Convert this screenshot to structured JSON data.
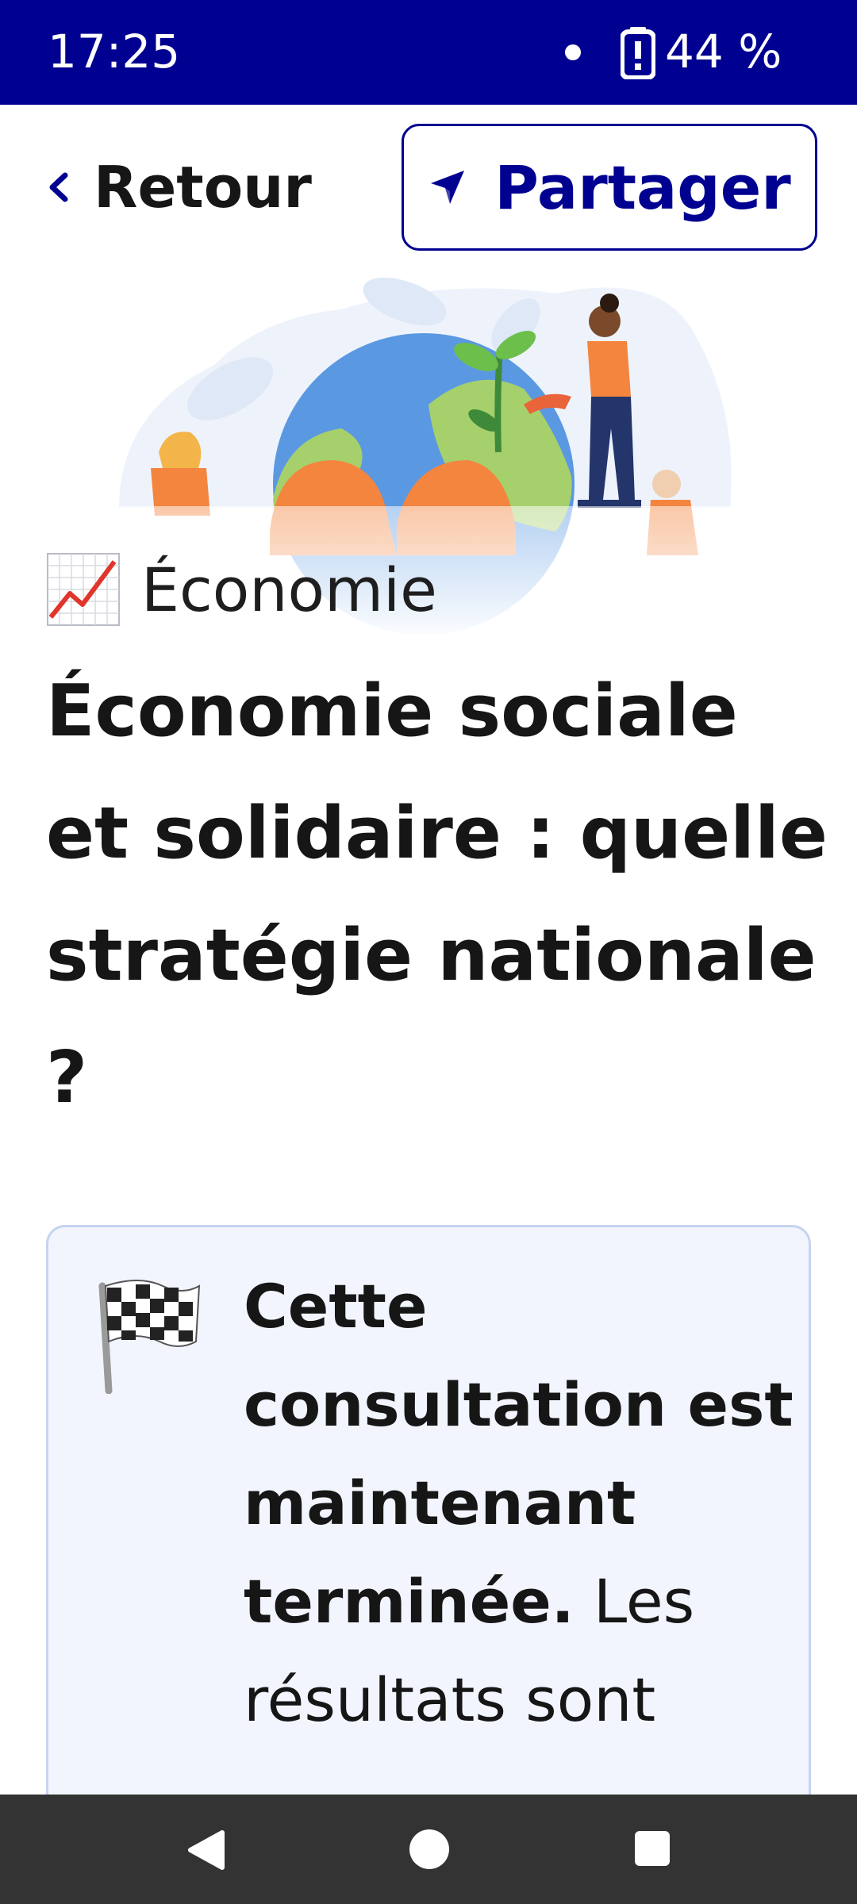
{
  "status_bar": {
    "time": "17:25",
    "battery": "44 %"
  },
  "header": {
    "back_label": "Retour",
    "share_label": "Partager"
  },
  "hero": {
    "image": "people-caring-for-earth-illustration"
  },
  "category": {
    "icon": "chart-increasing-emoji",
    "label": "Économie"
  },
  "title": "Économie sociale et solidaire : quelle stratégie nationale ?",
  "notice": {
    "icon": "checkered-flag-emoji",
    "strong_text": "Cette consultation est maintenant terminée.",
    "text": " Les résultats sont"
  },
  "colors": {
    "primary": "#000091",
    "notice_bg": "#f2f5fd",
    "notice_border": "#c6d4f0",
    "nav_bar": "#333333"
  },
  "nav_bar": {
    "icons": [
      "back-triangle-icon",
      "home-circle-icon",
      "recents-square-icon"
    ]
  }
}
